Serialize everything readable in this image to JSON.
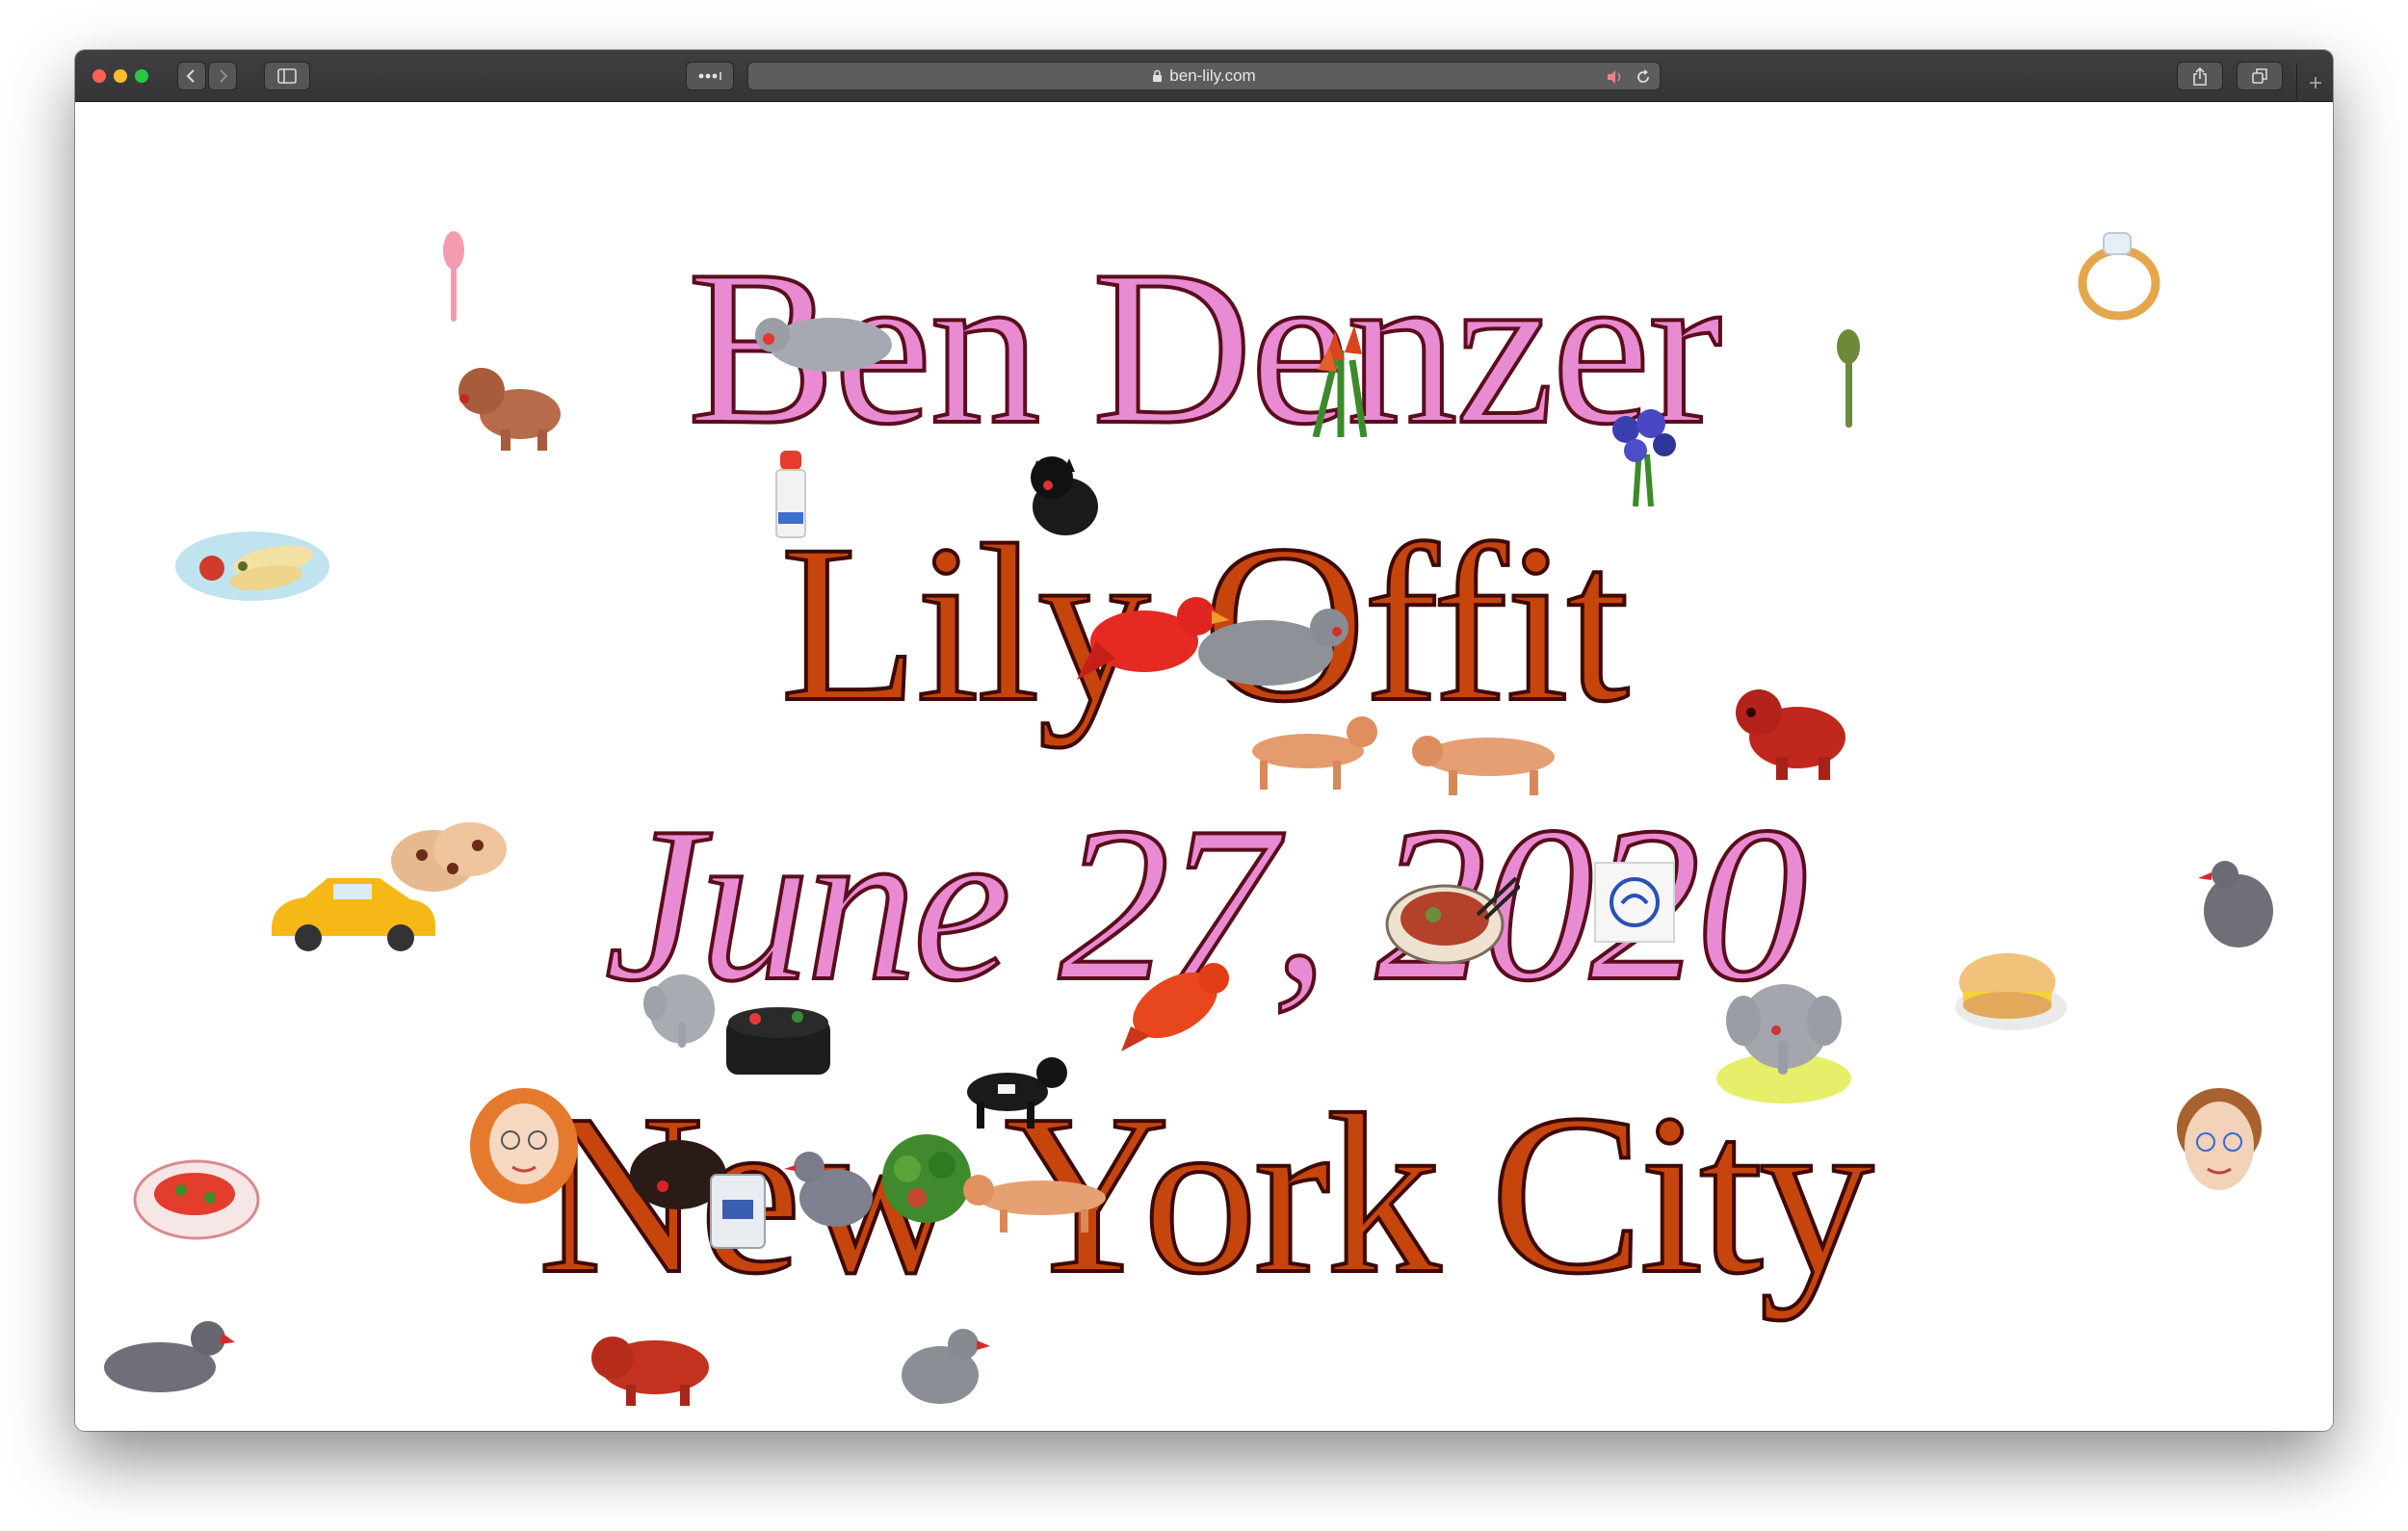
{
  "browser": {
    "url": "ben-lily.com",
    "icons": {
      "back": "chevron-left-icon",
      "forward": "chevron-right-icon",
      "sidebar": "sidebar-icon",
      "more": "ellipsis-icon",
      "lock": "lock-icon",
      "audio": "speaker-icon",
      "reload": "reload-icon",
      "share": "share-icon",
      "tabs": "tabs-overview-icon",
      "new_tab": "plus-icon"
    },
    "traffic_lights": [
      "#fe5f57",
      "#febc2e",
      "#28c840"
    ]
  },
  "page": {
    "line1": "Ben Denzer",
    "line2": "Lily Offit",
    "line3": "June 27, 2020",
    "line4": "New York City",
    "colors": {
      "pink": "#e98bd2",
      "rust": "#c6450c",
      "outline": "#3d0a06"
    },
    "doodles": [
      "spoon-icon",
      "dog-icon",
      "dumpling-plate-icon",
      "pigeon-icon",
      "spray-bottle-icon",
      "black-dog-icon",
      "flowers-icon",
      "iris-icon",
      "olive-spoon-icon",
      "ring-icon",
      "cardinal-icon",
      "dachshund-icon",
      "red-dog-icon",
      "taxi-icon",
      "cookie-icon",
      "soup-bowl-icon",
      "matchbook-icon",
      "bagel-sandwich-icon",
      "elephant-icon",
      "caviar-tin-icon",
      "woman-face-icon",
      "man-face-icon",
      "pizza-plate-icon",
      "salad-icon",
      "cup-icon"
    ]
  }
}
